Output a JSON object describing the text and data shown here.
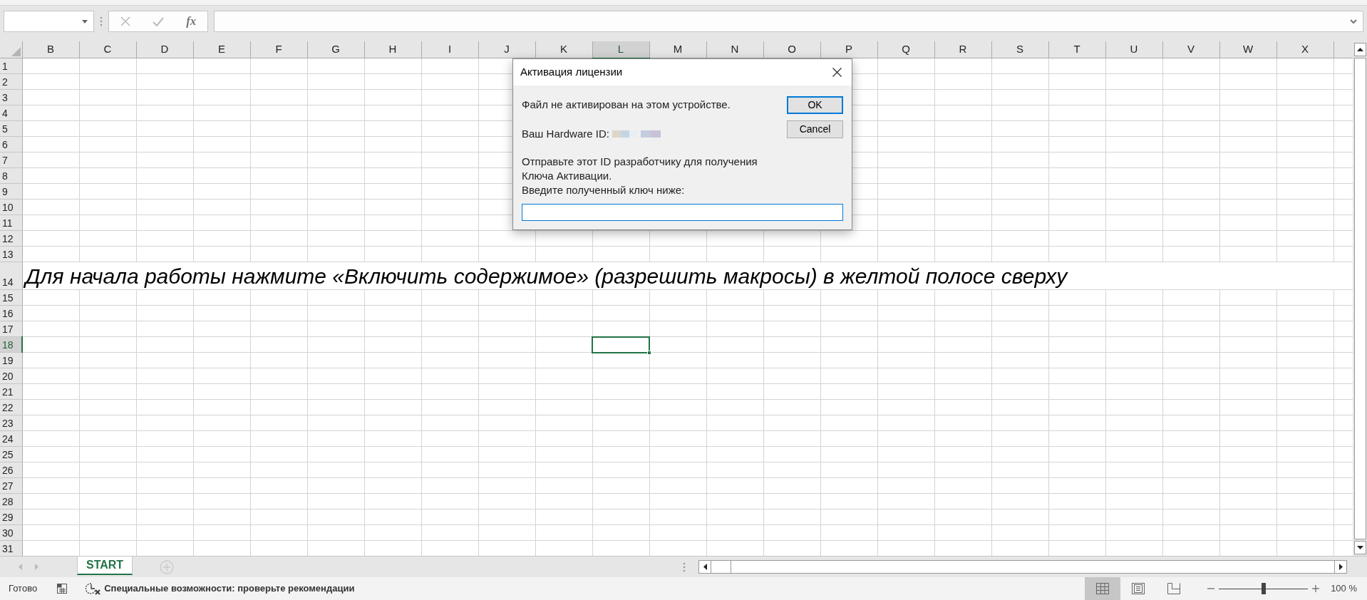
{
  "formula_bar": {
    "function_label": "fx"
  },
  "columns": [
    {
      "label": "B",
      "selected": false
    },
    {
      "label": "C",
      "selected": false
    },
    {
      "label": "D",
      "selected": false
    },
    {
      "label": "E",
      "selected": false
    },
    {
      "label": "F",
      "selected": false
    },
    {
      "label": "G",
      "selected": false
    },
    {
      "label": "H",
      "selected": false
    },
    {
      "label": "I",
      "selected": false
    },
    {
      "label": "J",
      "selected": false
    },
    {
      "label": "K",
      "selected": false
    },
    {
      "label": "L",
      "selected": true
    },
    {
      "label": "M",
      "selected": false
    },
    {
      "label": "N",
      "selected": false
    },
    {
      "label": "O",
      "selected": false
    },
    {
      "label": "P",
      "selected": false
    },
    {
      "label": "Q",
      "selected": false
    },
    {
      "label": "R",
      "selected": false
    },
    {
      "label": "S",
      "selected": false
    },
    {
      "label": "T",
      "selected": false
    },
    {
      "label": "U",
      "selected": false
    },
    {
      "label": "V",
      "selected": false
    },
    {
      "label": "W",
      "selected": false
    },
    {
      "label": "X",
      "selected": false
    }
  ],
  "rows": [
    {
      "label": "1",
      "selected": false
    },
    {
      "label": "2",
      "selected": false
    },
    {
      "label": "3",
      "selected": false
    },
    {
      "label": "4",
      "selected": false
    },
    {
      "label": "5",
      "selected": false
    },
    {
      "label": "6",
      "selected": false
    },
    {
      "label": "7",
      "selected": false
    },
    {
      "label": "8",
      "selected": false
    },
    {
      "label": "9",
      "selected": false
    },
    {
      "label": "10",
      "selected": false
    },
    {
      "label": "11",
      "selected": false
    },
    {
      "label": "12",
      "selected": false
    },
    {
      "label": "13",
      "selected": false
    },
    {
      "label": "14",
      "selected": false,
      "text": "Для начала работы нажмите «Включить содержимое» (разрешить макросы) в желтой полосе сверху"
    },
    {
      "label": "15",
      "selected": false
    },
    {
      "label": "16",
      "selected": false
    },
    {
      "label": "17",
      "selected": false
    },
    {
      "label": "18",
      "selected": true
    },
    {
      "label": "19",
      "selected": false
    },
    {
      "label": "20",
      "selected": false
    },
    {
      "label": "21",
      "selected": false
    },
    {
      "label": "22",
      "selected": false
    },
    {
      "label": "23",
      "selected": false
    },
    {
      "label": "24",
      "selected": false
    },
    {
      "label": "25",
      "selected": false
    },
    {
      "label": "26",
      "selected": false
    },
    {
      "label": "27",
      "selected": false
    },
    {
      "label": "28",
      "selected": false
    },
    {
      "label": "29",
      "selected": false
    },
    {
      "label": "30",
      "selected": false
    },
    {
      "label": "31",
      "selected": false
    }
  ],
  "dialog": {
    "title": "Активация лицензии",
    "message": "Файл не активирован на этом устройстве.",
    "hardware_id_label": "Ваш Hardware ID:",
    "instructions": [
      "Отправьте этот ID разработчику для получения",
      "Ключа Активации.",
      "Введите полученный ключ ниже:"
    ],
    "buttons": [
      {
        "label": "OK",
        "default": true
      },
      {
        "label": "Cancel",
        "default": false
      }
    ],
    "key_field": {
      "focused": true
    }
  },
  "sheet_tabs": [
    {
      "label": "START",
      "selected": true
    }
  ],
  "status_bar": {
    "mode": "Готово",
    "accessibility": "Специальные возможности: проверьте рекомендации",
    "views": [
      {
        "kind": "normal",
        "selected": true
      },
      {
        "kind": "page_layout",
        "selected": false
      },
      {
        "kind": "page_break",
        "selected": false
      }
    ],
    "zoom": {
      "level": 0.5,
      "reading": "100 %"
    }
  }
}
